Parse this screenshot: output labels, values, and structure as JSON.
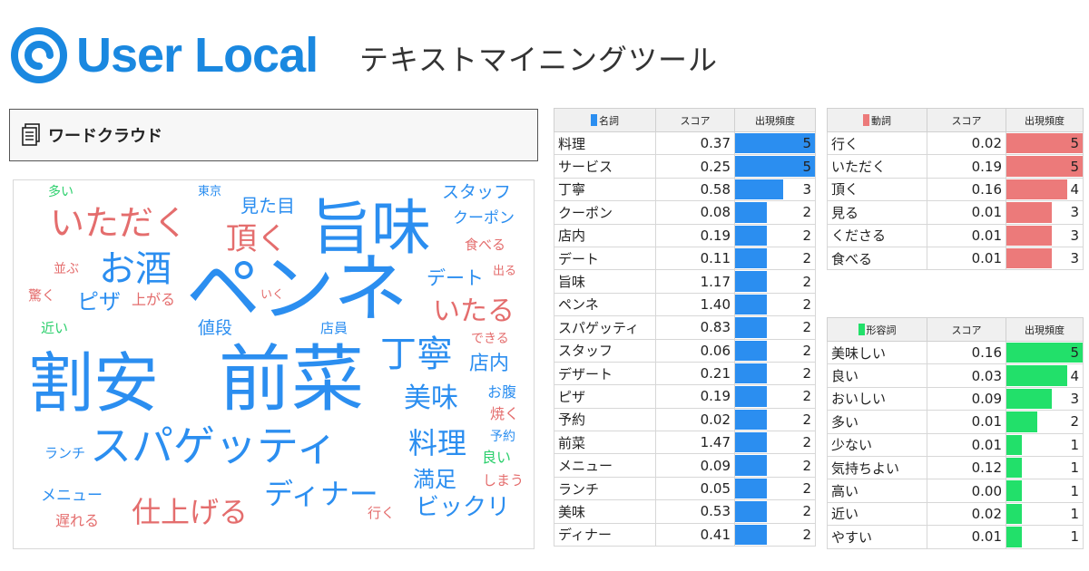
{
  "header": {
    "brand": "User Local",
    "tagline": "テキストマイニングツール"
  },
  "wordcloud": {
    "title": "ワードクラウド",
    "words": [
      {
        "text": "多い",
        "color": "g"
      },
      {
        "text": "東京",
        "color": "b"
      },
      {
        "text": "見た目",
        "color": "b"
      },
      {
        "text": "スタッフ",
        "color": "b"
      },
      {
        "text": "いただく",
        "color": "r"
      },
      {
        "text": "旨味",
        "color": "b"
      },
      {
        "text": "クーポン",
        "color": "b"
      },
      {
        "text": "頂く",
        "color": "r"
      },
      {
        "text": "食べる",
        "color": "r"
      },
      {
        "text": "お酒",
        "color": "b"
      },
      {
        "text": "並ぶ",
        "color": "r"
      },
      {
        "text": "出る",
        "color": "r"
      },
      {
        "text": "ペンネ",
        "color": "b"
      },
      {
        "text": "デート",
        "color": "b"
      },
      {
        "text": "驚く",
        "color": "r"
      },
      {
        "text": "ピザ",
        "color": "b"
      },
      {
        "text": "上がる",
        "color": "r"
      },
      {
        "text": "いく",
        "color": "r"
      },
      {
        "text": "いたる",
        "color": "r"
      },
      {
        "text": "近い",
        "color": "g"
      },
      {
        "text": "値段",
        "color": "b"
      },
      {
        "text": "店員",
        "color": "b"
      },
      {
        "text": "できる",
        "color": "r"
      },
      {
        "text": "丁寧",
        "color": "b"
      },
      {
        "text": "割安",
        "color": "b"
      },
      {
        "text": "前菜",
        "color": "b"
      },
      {
        "text": "店内",
        "color": "b"
      },
      {
        "text": "お腹",
        "color": "b"
      },
      {
        "text": "美味",
        "color": "b"
      },
      {
        "text": "焼く",
        "color": "r"
      },
      {
        "text": "予約",
        "color": "b"
      },
      {
        "text": "ランチ",
        "color": "b"
      },
      {
        "text": "スパゲッティ",
        "color": "b"
      },
      {
        "text": "料理",
        "color": "b"
      },
      {
        "text": "良い",
        "color": "g"
      },
      {
        "text": "満足",
        "color": "b"
      },
      {
        "text": "しまう",
        "color": "r"
      },
      {
        "text": "メニュー",
        "color": "b"
      },
      {
        "text": "ディナー",
        "color": "b"
      },
      {
        "text": "仕上げる",
        "color": "r"
      },
      {
        "text": "遅れる",
        "color": "r"
      },
      {
        "text": "行く",
        "color": "r"
      },
      {
        "text": "ビックリ",
        "color": "b"
      }
    ]
  },
  "tables": {
    "columns": {
      "score": "スコア",
      "freq": "出現頻度"
    },
    "max_freq": 5,
    "noun": {
      "label": "名詞",
      "color": "#2b8ef0",
      "rows": [
        {
          "word": "料理",
          "score": "0.37",
          "freq": 5
        },
        {
          "word": "サービス",
          "score": "0.25",
          "freq": 5
        },
        {
          "word": "丁寧",
          "score": "0.58",
          "freq": 3
        },
        {
          "word": "クーポン",
          "score": "0.08",
          "freq": 2
        },
        {
          "word": "店内",
          "score": "0.19",
          "freq": 2
        },
        {
          "word": "デート",
          "score": "0.11",
          "freq": 2
        },
        {
          "word": "旨味",
          "score": "1.17",
          "freq": 2
        },
        {
          "word": "ペンネ",
          "score": "1.40",
          "freq": 2
        },
        {
          "word": "スパゲッティ",
          "score": "0.83",
          "freq": 2
        },
        {
          "word": "スタッフ",
          "score": "0.06",
          "freq": 2
        },
        {
          "word": "デザート",
          "score": "0.21",
          "freq": 2
        },
        {
          "word": "ピザ",
          "score": "0.19",
          "freq": 2
        },
        {
          "word": "予約",
          "score": "0.02",
          "freq": 2
        },
        {
          "word": "前菜",
          "score": "1.47",
          "freq": 2
        },
        {
          "word": "メニュー",
          "score": "0.09",
          "freq": 2
        },
        {
          "word": "ランチ",
          "score": "0.05",
          "freq": 2
        },
        {
          "word": "美味",
          "score": "0.53",
          "freq": 2
        },
        {
          "word": "ディナー",
          "score": "0.41",
          "freq": 2
        }
      ]
    },
    "verb": {
      "label": "動詞",
      "color": "#ec7a7a",
      "rows": [
        {
          "word": "行く",
          "score": "0.02",
          "freq": 5
        },
        {
          "word": "いただく",
          "score": "0.19",
          "freq": 5
        },
        {
          "word": "頂く",
          "score": "0.16",
          "freq": 4
        },
        {
          "word": "見る",
          "score": "0.01",
          "freq": 3
        },
        {
          "word": "くださる",
          "score": "0.01",
          "freq": 3
        },
        {
          "word": "食べる",
          "score": "0.01",
          "freq": 3
        }
      ]
    },
    "adj": {
      "label": "形容詞",
      "color": "#22e06a",
      "rows": [
        {
          "word": "美味しい",
          "score": "0.16",
          "freq": 5
        },
        {
          "word": "良い",
          "score": "0.03",
          "freq": 4
        },
        {
          "word": "おいしい",
          "score": "0.09",
          "freq": 3
        },
        {
          "word": "多い",
          "score": "0.01",
          "freq": 2
        },
        {
          "word": "少ない",
          "score": "0.01",
          "freq": 1
        },
        {
          "word": "気持ちよい",
          "score": "0.12",
          "freq": 1
        },
        {
          "word": "高い",
          "score": "0.00",
          "freq": 1
        },
        {
          "word": "近い",
          "score": "0.02",
          "freq": 1
        },
        {
          "word": "やすい",
          "score": "0.01",
          "freq": 1
        }
      ]
    }
  }
}
